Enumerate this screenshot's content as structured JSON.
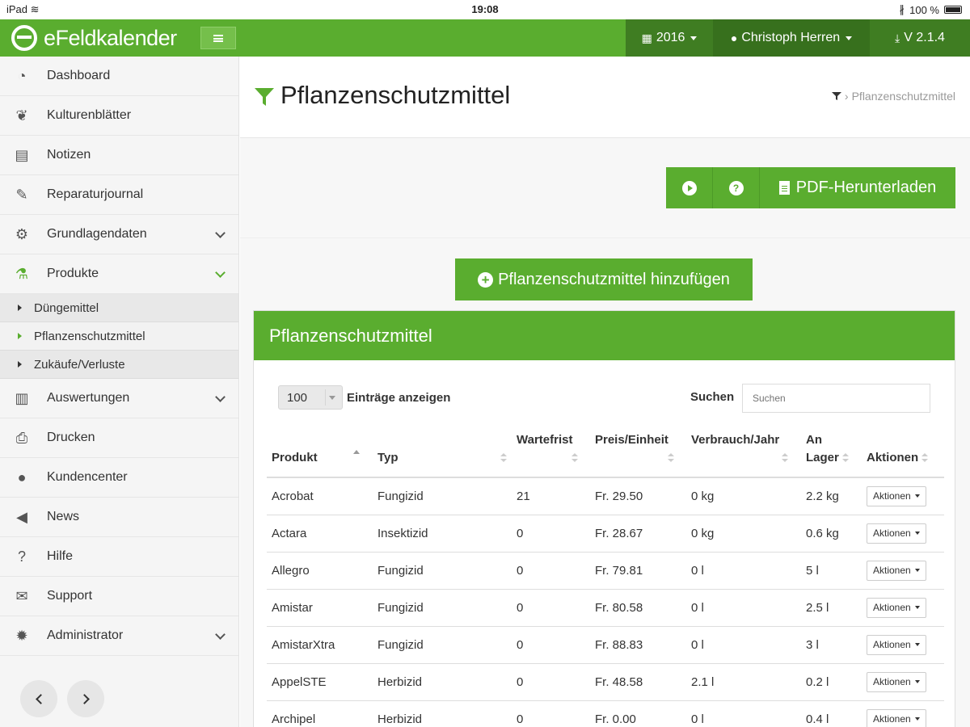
{
  "status_bar": {
    "device": "iPad",
    "time": "19:08",
    "battery": "100 %"
  },
  "navbar": {
    "brand": "eFeldkalender",
    "year": "2016",
    "user": "Christoph Herren",
    "version": "V 2.1.4"
  },
  "sidebar": {
    "items": [
      {
        "label": "Dashboard",
        "icon": "dashboard-icon"
      },
      {
        "label": "Kulturenblätter",
        "icon": "leaf-icon"
      },
      {
        "label": "Notizen",
        "icon": "document-icon"
      },
      {
        "label": "Reparaturjournal",
        "icon": "wrench-icon"
      },
      {
        "label": "Grundlagendaten",
        "icon": "gears-icon"
      },
      {
        "label": "Produkte",
        "icon": "flask-icon"
      },
      {
        "label": "Auswertungen",
        "icon": "bar-chart-icon"
      },
      {
        "label": "Drucken",
        "icon": "printer-icon"
      },
      {
        "label": "Kundencenter",
        "icon": "user-icon"
      },
      {
        "label": "News",
        "icon": "megaphone-icon"
      },
      {
        "label": "Hilfe",
        "icon": "question-icon"
      },
      {
        "label": "Support",
        "icon": "envelope-icon"
      },
      {
        "label": "Administrator",
        "icon": "gear-icon"
      }
    ],
    "sub_items": [
      "Düngemittel",
      "Pflanzenschutzmittel",
      "Zukäufe/Verluste"
    ]
  },
  "page": {
    "title": "Pflanzenschutzmittel",
    "breadcrumb": "Pflanzenschutzmittel",
    "pdf_button": "PDF-Herunterladen",
    "add_button": "Pflanzenschutzmittel hinzufügen",
    "panel_title": "Pflanzenschutzmittel"
  },
  "table_controls": {
    "page_length": "100",
    "length_label": "Einträge anzeigen",
    "search_label": "Suchen",
    "search_placeholder": "Suchen"
  },
  "table": {
    "columns": [
      "Produkt",
      "Typ",
      "Wartefrist",
      "Preis/Einheit",
      "Verbrauch/Jahr",
      "An",
      "Lager",
      "Aktionen"
    ],
    "action_label": "Aktionen",
    "rows": [
      {
        "produkt": "Acrobat",
        "typ": "Fungizid",
        "wartefrist": "21",
        "preis": "Fr. 29.50",
        "verbrauch": "0 kg",
        "lager": "2.2 kg"
      },
      {
        "produkt": "Actara",
        "typ": "Insektizid",
        "wartefrist": "0",
        "preis": "Fr. 28.67",
        "verbrauch": "0 kg",
        "lager": "0.6 kg"
      },
      {
        "produkt": "Allegro",
        "typ": "Fungizid",
        "wartefrist": "0",
        "preis": "Fr. 79.81",
        "verbrauch": "0 l",
        "lager": "5 l"
      },
      {
        "produkt": "Amistar",
        "typ": "Fungizid",
        "wartefrist": "0",
        "preis": "Fr. 80.58",
        "verbrauch": "0 l",
        "lager": "2.5 l"
      },
      {
        "produkt": "AmistarXtra",
        "typ": "Fungizid",
        "wartefrist": "0",
        "preis": "Fr. 88.83",
        "verbrauch": "0 l",
        "lager": "3 l"
      },
      {
        "produkt": "AppelSTE",
        "typ": "Herbizid",
        "wartefrist": "0",
        "preis": "Fr. 48.58",
        "verbrauch": "2.1 l",
        "lager": "0.2 l"
      },
      {
        "produkt": "Archipel",
        "typ": "Herbizid",
        "wartefrist": "0",
        "preis": "Fr. 0.00",
        "verbrauch": "0 l",
        "lager": "0.4 l"
      }
    ]
  },
  "colors": {
    "accent": "#5aad2f",
    "accent_dark": "#3f7d22"
  }
}
